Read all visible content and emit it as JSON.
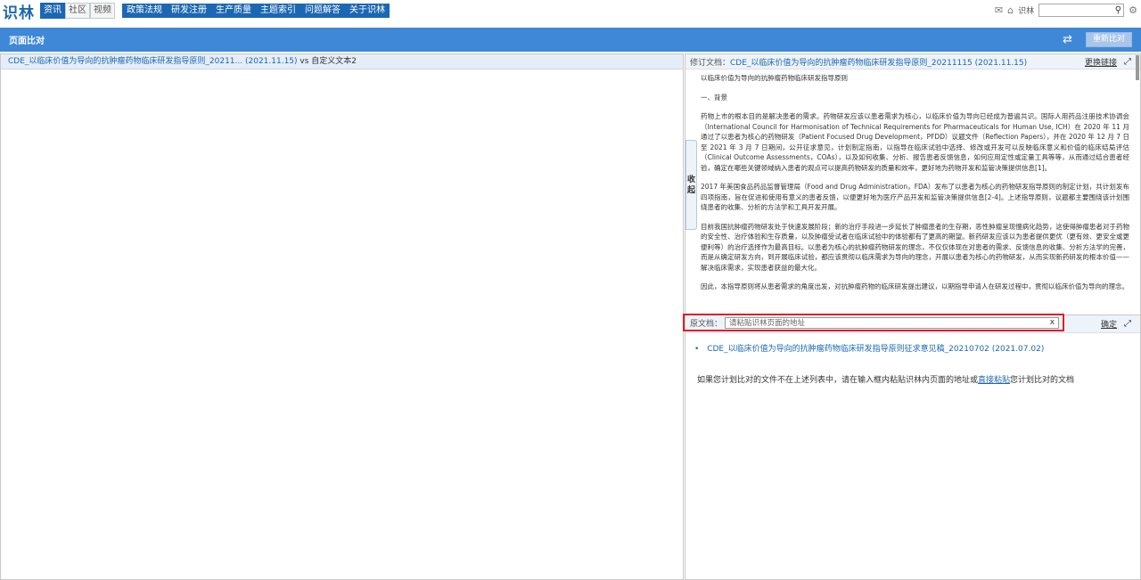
{
  "nav": {
    "logo": "识林",
    "segments": [
      "资讯",
      "社区",
      "视频"
    ],
    "menu": [
      "政策法规",
      "研发注册",
      "生产质量",
      "主题索引",
      "问题解答",
      "关于识林"
    ],
    "user_label": "识林",
    "search_placeholder": ""
  },
  "bar": {
    "title": "页面比对",
    "recompare_label": "重新比对"
  },
  "left": {
    "doc_title": "CDE_以临床价值为导向的抗肿瘤药物临床研发指导原则_20211... (2021.11.15)",
    "vs": "vs",
    "other": "自定义文本2"
  },
  "revised": {
    "label": "修订文档：",
    "doc": "CDE_以临床价值为导向的抗肿瘤药物临床研发指导原则_20211115 (2021.11.15)",
    "action": "更换链接",
    "paragraphs": [
      "以临床价值为导向的抗肿瘤药物临床研发指导原则",
      "一、背景",
      "药物上市的根本目的是解决患者的需求。药物研发应该以患者需求为核心，以临床价值为导向已经成为普遍共识。国际人用药品注册技术协调会（International Council for Harmonisation of Technical Requirements for Pharmaceuticals for Human Use, ICH）在 2020 年 11 月通过了以患者为核心的药物研发（Patient Focused Drug Development，PFDD）议题文件（Reflection Papers），并在 2020 年 12 月 7 日至 2021 年 3 月 7 日期间，公开征求意见，计划制定指南，以指导在临床试验中选择、修改或开发可以反映临床意义和价值的临床结局评估（Clinical Outcome Assessments，COAs），以及如何收集、分析、报告患者反馈信息，如何应用定性或定量工具等等，从而通过结合患者经验，确定在哪些关键领域纳入患者的观点可以提高药物研发的质量和效率，更好地为药物开发和监管决策提供信息[1]。",
      "2017 年美国食品药品监督管理局（Food and Drug Administration，FDA）发布了以患者为核心的药物研发指导原则的制定计划，共计划发布四项指南，旨在促进和使用有意义的患者反馈，以便更好地为医疗产品开发和监管决策提供信息[2-4]。上述指导原则，议题都主要围绕该计划围绕患者的收集、分析的方法学和工具开发开展。",
      "目前我国抗肿瘤药物研发处于快速发展阶段；新的治疗手段进一步延长了肿瘤患者的生存期，恶性肿瘤呈现慢病化趋势，这使得肿瘤患者对于药物的安全性、治疗体验和生存质量，以及肿瘤受试者在临床试验中的体验都有了更高的期望。新药研发应该以为患者提供更优（更有效、更安全或更便利等）的治疗选择作为最高目标。以患者为核心的抗肿瘤药物研发的理念，不仅仅体现在对患者的需求、反馈信息的收集、分析方法学的完善，而是从确定研发方向，到开展临床试验，都应该贯彻以临床需求为导向的理念，开展以患者为核心的药物研发，从而实现新药研发的根本价值——解决临床需求，实现患者获益的最大化。",
      "因此，本指导原则将从患者需求的角度出发，对抗肿瘤药物的临床研发提出建议，以期指导申请人在研发过程中，贯彻以临床价值为导向的理念。"
    ]
  },
  "collapse": {
    "chars": [
      "收",
      "起"
    ]
  },
  "source": {
    "label": "原文档：",
    "placeholder": "请粘贴识林页面的地址",
    "clear": "x",
    "action": "确定",
    "candidates": [
      {
        "title": "CDE_以临床价值为导向的抗肿瘤药物临床研发指导原则征求意见稿_20210702",
        "date": "(2021.07.02)"
      }
    ],
    "note_prefix": "如果您计划比对的文件不在上述列表中，请在输入框内粘贴识林内页面的地址或",
    "note_link": "直接粘贴",
    "note_suffix": "您计划比对的文档"
  }
}
